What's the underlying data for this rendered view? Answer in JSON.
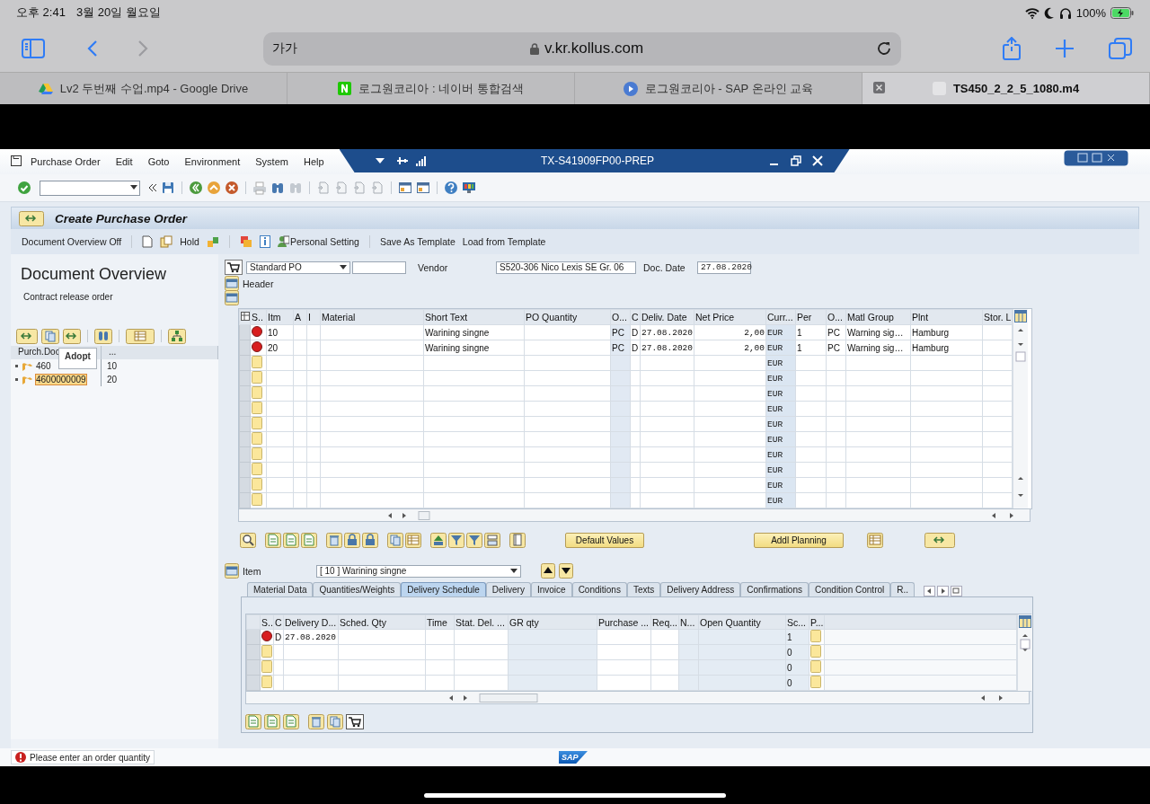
{
  "status_bar": {
    "time": "오후 2:41",
    "date": "3월 20일 월요일",
    "battery": "100%"
  },
  "browser": {
    "reader_button": "가가",
    "url": "v.kr.kollus.com",
    "tabs": [
      {
        "title": "Lv2 두번째 수업.mp4 - Google Drive",
        "selected": false,
        "kind": "drive"
      },
      {
        "title": "로그원코리아 : 네이버 통합검색",
        "selected": false,
        "kind": "naver"
      },
      {
        "title": "로그원코리아 - SAP 온라인 교육",
        "selected": false,
        "kind": "play"
      },
      {
        "title": "TS450_2_2_5_1080.m4",
        "selected": true,
        "kind": "file"
      }
    ]
  },
  "sap": {
    "menu": [
      "Purchase Order",
      "Edit",
      "Goto",
      "Environment",
      "System",
      "Help"
    ],
    "system": "TX-S41909FP00-PREP",
    "title": "Create Purchase Order",
    "app_toolbar": [
      "Document Overview Off",
      "Hold",
      "Personal Setting",
      "Save As Template",
      "Load from Template"
    ],
    "overview": {
      "title": "Document Overview",
      "subtitle": "Contract release order",
      "columns": [
        "Purch.Doc",
        "..."
      ],
      "tooltip": "Adopt",
      "rows": [
        {
          "document": "460",
          "item": "10",
          "selected": false
        },
        {
          "document": "4600000009",
          "item": "20",
          "selected": true
        }
      ]
    },
    "header": {
      "doc_type": "Standard PO",
      "vendor_label": "Vendor",
      "vendor": "S520-306 Nico Lexis SE Gr. 06",
      "date_label": "Doc. Date",
      "doc_date": "27.08.2020",
      "header_label": "Header"
    },
    "items": {
      "columns": [
        "S..",
        "Itm",
        "A",
        "I",
        "Material",
        "Short Text",
        "PO Quantity",
        "O...",
        "C",
        "Deliv. Date",
        "Net Price",
        "Curr...",
        "Per",
        "O...",
        "Matl Group",
        "Plnt",
        "Stor. L"
      ],
      "rows": [
        {
          "kind": "error",
          "item": "10",
          "short_text": "Warining singne",
          "order_unit": "PC",
          "date_category": "D",
          "delivery_date": "27.08.2020",
          "net_price": "2,00",
          "currency": "EUR",
          "per": "1",
          "price_unit": "PC",
          "matl_group": "Warning sig…",
          "plant": "Hamburg"
        },
        {
          "kind": "error",
          "item": "20",
          "short_text": "Warining singne",
          "order_unit": "PC",
          "date_category": "D",
          "delivery_date": "27.08.2020",
          "net_price": "2,00",
          "currency": "EUR",
          "per": "1",
          "price_unit": "PC",
          "matl_group": "Warning sig…",
          "plant": "Hamburg"
        },
        {
          "kind": "empty",
          "currency": "EUR"
        },
        {
          "kind": "empty",
          "currency": "EUR"
        },
        {
          "kind": "empty",
          "currency": "EUR"
        },
        {
          "kind": "empty",
          "currency": "EUR"
        },
        {
          "kind": "empty",
          "currency": "EUR"
        },
        {
          "kind": "empty",
          "currency": "EUR"
        },
        {
          "kind": "empty",
          "currency": "EUR"
        },
        {
          "kind": "empty",
          "currency": "EUR"
        },
        {
          "kind": "empty",
          "currency": "EUR"
        },
        {
          "kind": "empty",
          "currency": "EUR"
        }
      ]
    },
    "buttons": [
      "Default Values",
      "Addl Planning"
    ],
    "item_selector": {
      "label": "Item",
      "value": "[ 10 ] Warining singne"
    },
    "tabs": [
      {
        "label": "Material Data",
        "selected": false
      },
      {
        "label": "Quantities/Weights",
        "selected": false
      },
      {
        "label": "Delivery Schedule",
        "selected": true
      },
      {
        "label": "Delivery",
        "selected": false
      },
      {
        "label": "Invoice",
        "selected": false
      },
      {
        "label": "Conditions",
        "selected": false
      },
      {
        "label": "Texts",
        "selected": false
      },
      {
        "label": "Delivery Address",
        "selected": false
      },
      {
        "label": "Confirmations",
        "selected": false
      },
      {
        "label": "Condition Control",
        "selected": false
      },
      {
        "label": "R..",
        "selected": false
      }
    ],
    "schedule": {
      "columns": [
        "S..",
        "C",
        "Delivery D...",
        "Sched. Qty",
        "Time",
        "Stat. Del. ...",
        "GR qty",
        "Purchase ...",
        "Req...",
        "N...",
        "Open Quantity",
        "Sc...",
        "P..."
      ],
      "rows": [
        {
          "kind": "error",
          "date_category": "D",
          "delivery_date": "27.08.2020",
          "sc": "1"
        },
        {
          "kind": "empty",
          "sc": "0"
        },
        {
          "kind": "empty",
          "sc": "0"
        },
        {
          "kind": "empty",
          "sc": "0"
        }
      ]
    },
    "message": {
      "kind": "error",
      "text": "Please enter an order quantity"
    },
    "logo": "SAP"
  }
}
